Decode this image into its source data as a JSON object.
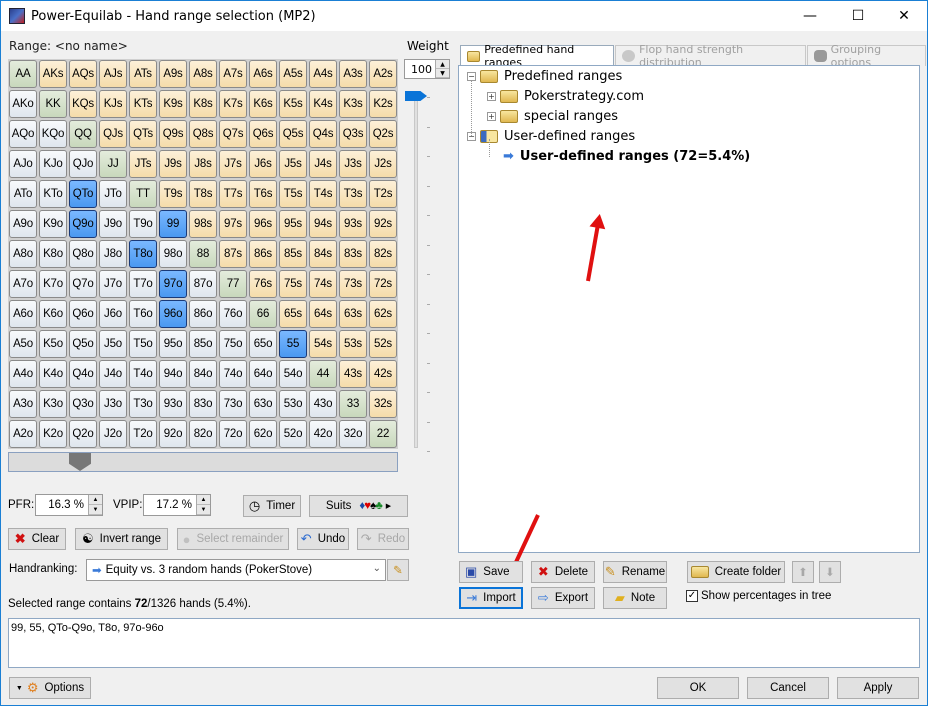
{
  "window": {
    "title": "Power-Equilab - Hand range selection (MP2)",
    "controls": {
      "minimize": "—",
      "maximize": "☐",
      "close": "✕"
    }
  },
  "range": {
    "label": "Range: <no name>"
  },
  "weight": {
    "label": "Weight",
    "value": "100",
    "slider_percent": 100
  },
  "grid": {
    "rows": [
      [
        [
          "AA",
          "p"
        ],
        [
          "AKs",
          "s"
        ],
        [
          "AQs",
          "s"
        ],
        [
          "AJs",
          "s"
        ],
        [
          "ATs",
          "s"
        ],
        [
          "A9s",
          "s"
        ],
        [
          "A8s",
          "s"
        ],
        [
          "A7s",
          "s"
        ],
        [
          "A6s",
          "s"
        ],
        [
          "A5s",
          "s"
        ],
        [
          "A4s",
          "s"
        ],
        [
          "A3s",
          "s"
        ],
        [
          "A2s",
          "s"
        ]
      ],
      [
        [
          "AKo",
          "o"
        ],
        [
          "KK",
          "p"
        ],
        [
          "KQs",
          "s"
        ],
        [
          "KJs",
          "s"
        ],
        [
          "KTs",
          "s"
        ],
        [
          "K9s",
          "s"
        ],
        [
          "K8s",
          "s"
        ],
        [
          "K7s",
          "s"
        ],
        [
          "K6s",
          "s"
        ],
        [
          "K5s",
          "s"
        ],
        [
          "K4s",
          "s"
        ],
        [
          "K3s",
          "s"
        ],
        [
          "K2s",
          "s"
        ]
      ],
      [
        [
          "AQo",
          "o"
        ],
        [
          "KQo",
          "o"
        ],
        [
          "QQ",
          "p"
        ],
        [
          "QJs",
          "s"
        ],
        [
          "QTs",
          "s"
        ],
        [
          "Q9s",
          "s"
        ],
        [
          "Q8s",
          "s"
        ],
        [
          "Q7s",
          "s"
        ],
        [
          "Q6s",
          "s"
        ],
        [
          "Q5s",
          "s"
        ],
        [
          "Q4s",
          "s"
        ],
        [
          "Q3s",
          "s"
        ],
        [
          "Q2s",
          "s"
        ]
      ],
      [
        [
          "AJo",
          "o"
        ],
        [
          "KJo",
          "o"
        ],
        [
          "QJo",
          "o"
        ],
        [
          "JJ",
          "p"
        ],
        [
          "JTs",
          "s"
        ],
        [
          "J9s",
          "s"
        ],
        [
          "J8s",
          "s"
        ],
        [
          "J7s",
          "s"
        ],
        [
          "J6s",
          "s"
        ],
        [
          "J5s",
          "s"
        ],
        [
          "J4s",
          "s"
        ],
        [
          "J3s",
          "s"
        ],
        [
          "J2s",
          "s"
        ]
      ],
      [
        [
          "ATo",
          "o"
        ],
        [
          "KTo",
          "o"
        ],
        [
          "QTo",
          "sel"
        ],
        [
          "JTo",
          "o"
        ],
        [
          "TT",
          "p"
        ],
        [
          "T9s",
          "s"
        ],
        [
          "T8s",
          "s"
        ],
        [
          "T7s",
          "s"
        ],
        [
          "T6s",
          "s"
        ],
        [
          "T5s",
          "s"
        ],
        [
          "T4s",
          "s"
        ],
        [
          "T3s",
          "s"
        ],
        [
          "T2s",
          "s"
        ]
      ],
      [
        [
          "A9o",
          "o"
        ],
        [
          "K9o",
          "o"
        ],
        [
          "Q9o",
          "sel"
        ],
        [
          "J9o",
          "o"
        ],
        [
          "T9o",
          "o"
        ],
        [
          "99",
          "sel"
        ],
        [
          "98s",
          "s"
        ],
        [
          "97s",
          "s"
        ],
        [
          "96s",
          "s"
        ],
        [
          "95s",
          "s"
        ],
        [
          "94s",
          "s"
        ],
        [
          "93s",
          "s"
        ],
        [
          "92s",
          "s"
        ]
      ],
      [
        [
          "A8o",
          "o"
        ],
        [
          "K8o",
          "o"
        ],
        [
          "Q8o",
          "o"
        ],
        [
          "J8o",
          "o"
        ],
        [
          "T8o",
          "sel"
        ],
        [
          "98o",
          "o"
        ],
        [
          "88",
          "p"
        ],
        [
          "87s",
          "s"
        ],
        [
          "86s",
          "s"
        ],
        [
          "85s",
          "s"
        ],
        [
          "84s",
          "s"
        ],
        [
          "83s",
          "s"
        ],
        [
          "82s",
          "s"
        ]
      ],
      [
        [
          "A7o",
          "o"
        ],
        [
          "K7o",
          "o"
        ],
        [
          "Q7o",
          "o"
        ],
        [
          "J7o",
          "o"
        ],
        [
          "T7o",
          "o"
        ],
        [
          "97o",
          "sel"
        ],
        [
          "87o",
          "o"
        ],
        [
          "77",
          "p"
        ],
        [
          "76s",
          "s"
        ],
        [
          "75s",
          "s"
        ],
        [
          "74s",
          "s"
        ],
        [
          "73s",
          "s"
        ],
        [
          "72s",
          "s"
        ]
      ],
      [
        [
          "A6o",
          "o"
        ],
        [
          "K6o",
          "o"
        ],
        [
          "Q6o",
          "o"
        ],
        [
          "J6o",
          "o"
        ],
        [
          "T6o",
          "o"
        ],
        [
          "96o",
          "sel"
        ],
        [
          "86o",
          "o"
        ],
        [
          "76o",
          "o"
        ],
        [
          "66",
          "p"
        ],
        [
          "65s",
          "s"
        ],
        [
          "64s",
          "s"
        ],
        [
          "63s",
          "s"
        ],
        [
          "62s",
          "s"
        ]
      ],
      [
        [
          "A5o",
          "o"
        ],
        [
          "K5o",
          "o"
        ],
        [
          "Q5o",
          "o"
        ],
        [
          "J5o",
          "o"
        ],
        [
          "T5o",
          "o"
        ],
        [
          "95o",
          "o"
        ],
        [
          "85o",
          "o"
        ],
        [
          "75o",
          "o"
        ],
        [
          "65o",
          "o"
        ],
        [
          "55",
          "sel"
        ],
        [
          "54s",
          "s"
        ],
        [
          "53s",
          "s"
        ],
        [
          "52s",
          "s"
        ]
      ],
      [
        [
          "A4o",
          "o"
        ],
        [
          "K4o",
          "o"
        ],
        [
          "Q4o",
          "o"
        ],
        [
          "J4o",
          "o"
        ],
        [
          "T4o",
          "o"
        ],
        [
          "94o",
          "o"
        ],
        [
          "84o",
          "o"
        ],
        [
          "74o",
          "o"
        ],
        [
          "64o",
          "o"
        ],
        [
          "54o",
          "o"
        ],
        [
          "44",
          "p"
        ],
        [
          "43s",
          "s"
        ],
        [
          "42s",
          "s"
        ]
      ],
      [
        [
          "A3o",
          "o"
        ],
        [
          "K3o",
          "o"
        ],
        [
          "Q3o",
          "o"
        ],
        [
          "J3o",
          "o"
        ],
        [
          "T3o",
          "o"
        ],
        [
          "93o",
          "o"
        ],
        [
          "83o",
          "o"
        ],
        [
          "73o",
          "o"
        ],
        [
          "63o",
          "o"
        ],
        [
          "53o",
          "o"
        ],
        [
          "43o",
          "o"
        ],
        [
          "33",
          "p"
        ],
        [
          "32s",
          "s"
        ]
      ],
      [
        [
          "A2o",
          "o"
        ],
        [
          "K2o",
          "o"
        ],
        [
          "Q2o",
          "o"
        ],
        [
          "J2o",
          "o"
        ],
        [
          "T2o",
          "o"
        ],
        [
          "92o",
          "o"
        ],
        [
          "82o",
          "o"
        ],
        [
          "72o",
          "o"
        ],
        [
          "62o",
          "o"
        ],
        [
          "52o",
          "o"
        ],
        [
          "42o",
          "o"
        ],
        [
          "32o",
          "o"
        ],
        [
          "22",
          "p"
        ]
      ]
    ]
  },
  "stats": {
    "pfr_label": "PFR:",
    "pfr_value": "16.3 %",
    "vpip_label": "VPIP:",
    "vpip_value": "17.2 %"
  },
  "buttons": {
    "timer": "Timer",
    "suits": "Suits",
    "suits_glyphs": "♦♥♠♣",
    "clear": "Clear",
    "invert": "Invert range",
    "select_remainder": "Select remainder",
    "undo": "Undo",
    "redo": "Redo",
    "save": "Save",
    "delete": "Delete",
    "rename": "Rename",
    "create_folder": "Create folder",
    "import": "Import",
    "export": "Export",
    "note": "Note",
    "options": "Options",
    "ok": "OK",
    "cancel": "Cancel",
    "apply": "Apply"
  },
  "handranking": {
    "label": "Handranking:",
    "value": "Equity vs. 3 random hands (PokerStove)"
  },
  "summary": {
    "prefix": "Selected range contains ",
    "count": "72",
    "suffix": "/1326 hands (5.4%)."
  },
  "range_text": "99, 55, QTo-Q9o, T8o, 97o-96o",
  "tabs": [
    {
      "label": "Predefined hand ranges",
      "active": true
    },
    {
      "label": "Flop hand strength distribution",
      "active": false
    },
    {
      "label": "Grouping options",
      "active": false
    }
  ],
  "tree": {
    "nodes": [
      {
        "label": "Predefined ranges",
        "expander": "−"
      },
      {
        "label": "Pokerstrategy.com",
        "expander": "+"
      },
      {
        "label": "special ranges",
        "expander": "+"
      },
      {
        "label": "User-defined ranges",
        "expander": "−"
      },
      {
        "label": "User-defined ranges (72=5.4%)",
        "bold": true
      }
    ]
  },
  "show_percentages": {
    "label": "Show percentages in tree",
    "checked": true
  }
}
